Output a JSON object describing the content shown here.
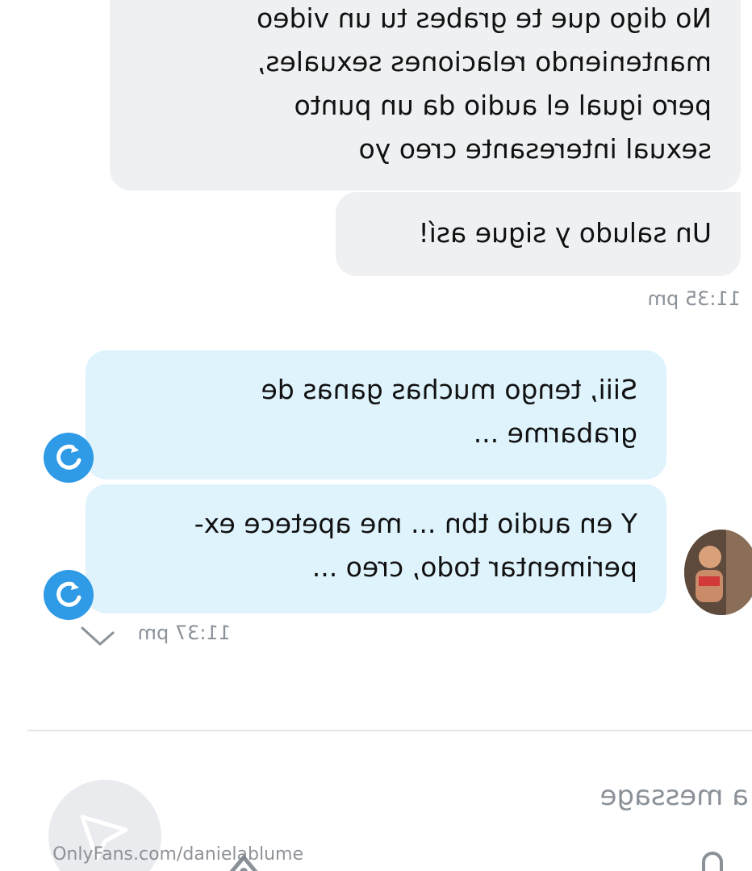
{
  "chat": {
    "received_bubble_1": {
      "lines": [
        "No digo que te grabes tu un video",
        "manteniendo relaciones sexuales,",
        "pero igual el audio da un punto",
        "sexual interesante creo yo"
      ]
    },
    "received_bubble_2": {
      "lines": [
        "Un saludo y sigue así!"
      ]
    },
    "received_time": "11:35 pm",
    "sent_bubble_1": {
      "lines": [
        "Siii, tengo muchas ganas de",
        "grabarme ..."
      ]
    },
    "sent_bubble_2": {
      "lines": [
        "Y en audio tbn ... me apetece ex-",
        "perimentar todo, creo ..."
      ]
    },
    "sent_time": "11:37 pm",
    "resend_icon": "retry-arrow-icon",
    "read_icon": "checkmark-icon"
  },
  "composer": {
    "placeholder": "a message",
    "send_icon": "send-paper-plane-icon",
    "attach_icon": "attachment-icon"
  },
  "watermark": "OnlyFans.com/danielablume",
  "colors": {
    "received_bubble": "#eef0f2",
    "sent_bubble": "#dff3fd",
    "accent": "#2f9ae6",
    "timestamp": "#8a9199"
  }
}
